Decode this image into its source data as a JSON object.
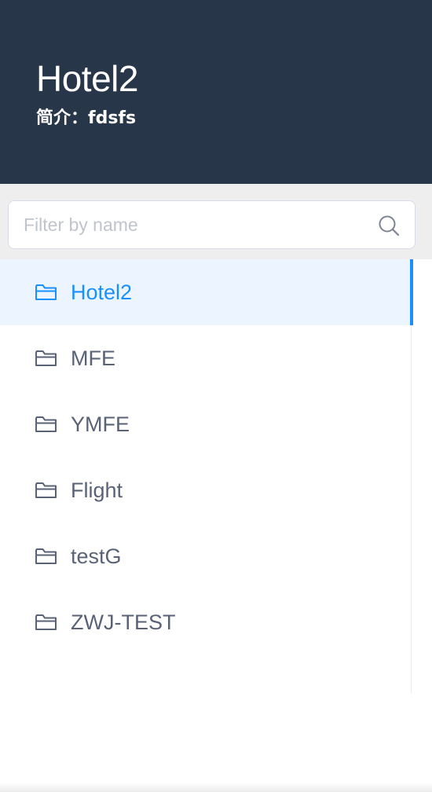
{
  "header": {
    "title": "Hotel2",
    "description": "简介：fdsfs"
  },
  "search": {
    "placeholder": "Filter by name",
    "value": "",
    "icon": "search-icon"
  },
  "groups": [
    {
      "label": "Hotel2",
      "icon": "folder-icon",
      "active": true
    },
    {
      "label": "MFE",
      "icon": "folder-icon",
      "active": false
    },
    {
      "label": "YMFE",
      "icon": "folder-icon",
      "active": false
    },
    {
      "label": "Flight",
      "icon": "folder-icon",
      "active": false
    },
    {
      "label": "testG",
      "icon": "folder-icon",
      "active": false
    },
    {
      "label": "ZWJ-TEST",
      "icon": "folder-icon",
      "active": false
    }
  ],
  "colors": {
    "header_bg": "#273649",
    "accent": "#1890ff",
    "active_bg": "#ecf5ff",
    "text": "#5a6277",
    "placeholder": "#c0c4cc"
  }
}
